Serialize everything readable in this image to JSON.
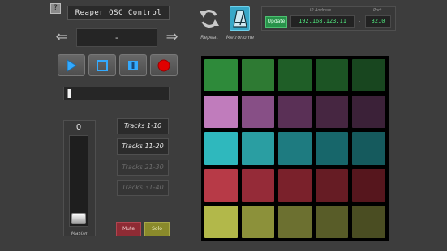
{
  "header": {
    "help_label": "?",
    "app_title": "Reaper OSC Control"
  },
  "navigation": {
    "prev_arrow": "⇐",
    "next_arrow": "⇒",
    "track_name": "-"
  },
  "transport": {
    "buttons": [
      "play",
      "stop",
      "pause",
      "record"
    ],
    "play_color": "#33aaff",
    "record_color": "#e00000"
  },
  "position": {
    "progress": 0.02
  },
  "master": {
    "volume_value": "0",
    "label": "Master",
    "fader_level": 0.1
  },
  "track_banks": [
    {
      "label": "Tracks 1-10",
      "active": true
    },
    {
      "label": "Tracks 11-20",
      "active": true
    },
    {
      "label": "Tracks 21-30",
      "active": false
    },
    {
      "label": "Tracks 31-40",
      "active": false
    }
  ],
  "buttons": {
    "mute_label": "Mute",
    "solo_label": "Solo"
  },
  "toolbar": {
    "repeat_label": "Repeat",
    "metronome_label": "Metronome",
    "metronome_color": "#38a8c8"
  },
  "connection": {
    "ip_label": "IP Address",
    "port_label": "Port",
    "update_label": "Update",
    "ip_value": "192.168.123.11",
    "separator": ":",
    "port_value": "3210"
  },
  "pads": {
    "rows": [
      [
        "#2e8a3a",
        "#2e7a33",
        "#1f5e27",
        "#1c5424",
        "#18461f"
      ],
      [
        "#c07cbc",
        "#874f86",
        "#5a3056",
        "#462641",
        "#3b2138"
      ],
      [
        "#2fb8bd",
        "#2a9ea2",
        "#1e7b80",
        "#17666a",
        "#155a5d"
      ],
      [
        "#b73a47",
        "#952b38",
        "#7a212b",
        "#661c24",
        "#56161d"
      ],
      [
        "#b2b84a",
        "#8c913a",
        "#6c7030",
        "#585c28",
        "#4a4d22"
      ]
    ]
  }
}
